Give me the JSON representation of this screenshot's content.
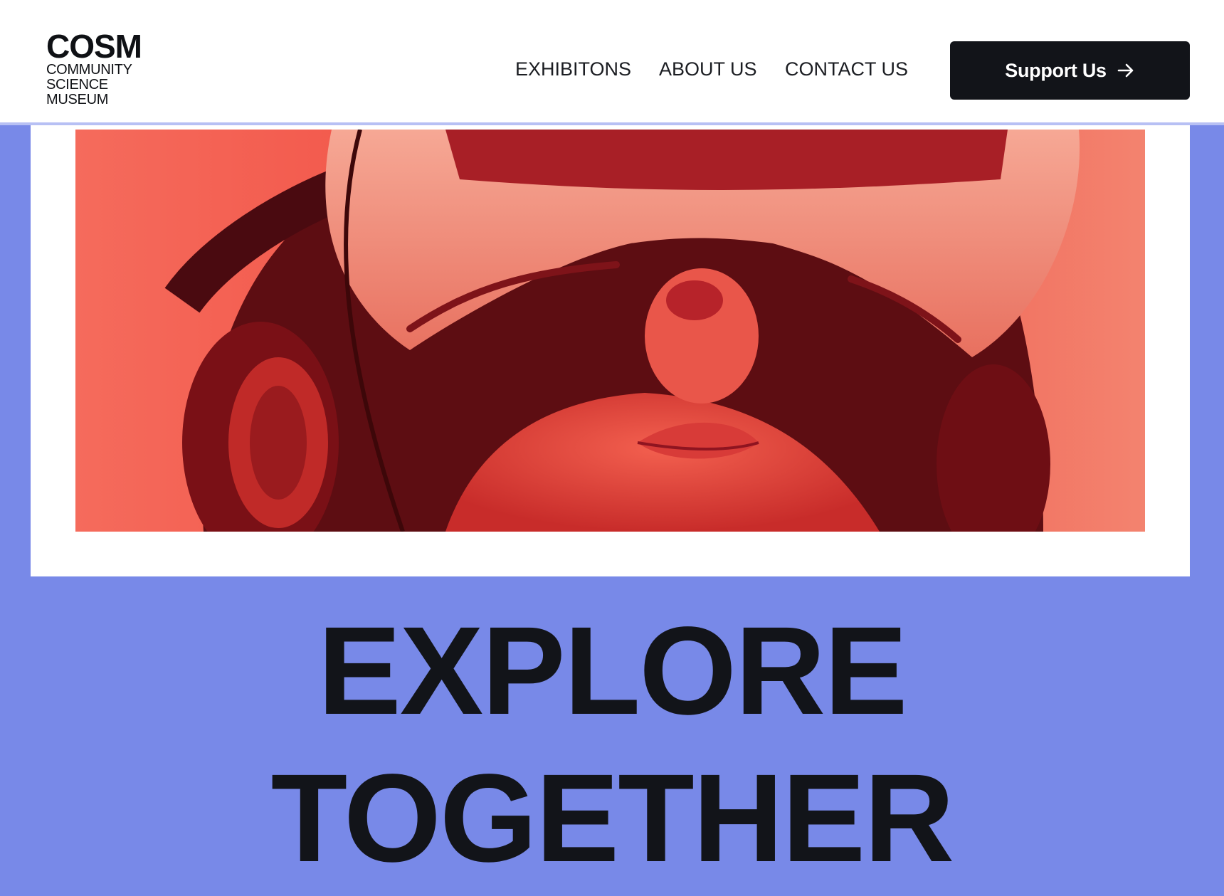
{
  "header": {
    "logo": {
      "main": "COSM",
      "sub_lines": [
        "COMMUNITY",
        "SCIENCE",
        "MUSEUM"
      ]
    },
    "nav": [
      {
        "label": "EXHIBITONS"
      },
      {
        "label": "ABOUT US"
      },
      {
        "label": "CONTACT US"
      }
    ],
    "cta": {
      "label": "Support Us",
      "icon": "arrow-right-icon"
    }
  },
  "hero": {
    "image_subject": "person wearing VR headset and headphones in red light",
    "headline_lines": [
      "EXPLORE",
      "TOGETHER"
    ]
  },
  "colors": {
    "page_background": "#7889e8",
    "header_background": "#ffffff",
    "header_divider": "#b7c0f4",
    "button_background": "#121419",
    "text_dark": "#121419",
    "image_tint": "#f25a4a"
  }
}
